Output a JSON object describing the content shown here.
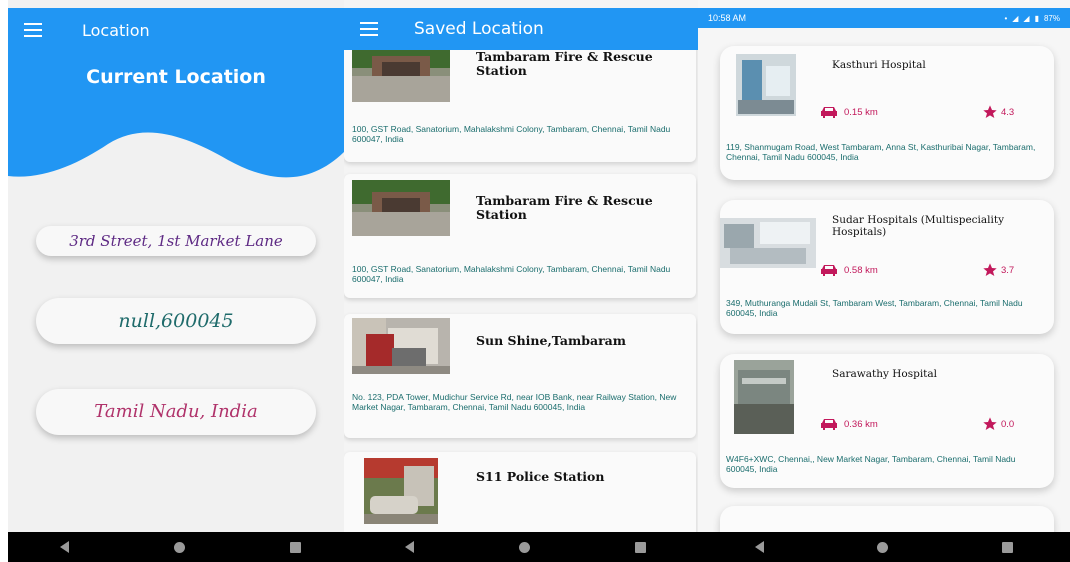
{
  "screen1": {
    "appbar_title": "Location",
    "header": "Current Location",
    "street": "3rd Street, 1st Market Lane",
    "zip": "null,600045",
    "state": "Tamil Nadu, India"
  },
  "screen2": {
    "appbar_title": "Saved Location",
    "items": [
      {
        "title": "Tambaram Fire & Rescue Station",
        "address": "100, GST Road, Sanatorium, Mahalakshmi Colony, Tambaram, Chennai, Tamil Nadu 600047, India"
      },
      {
        "title": "Tambaram Fire & Rescue Station",
        "address": "100, GST Road, Sanatorium, Mahalakshmi Colony, Tambaram, Chennai, Tamil Nadu 600047, India"
      },
      {
        "title": "Sun Shine,Tambaram",
        "address": "No. 123, PDA Tower, Mudichur Service Rd, near IOB Bank, near Railway Station, New Market Nagar, Tambaram, Chennai, Tamil Nadu 600045, India"
      },
      {
        "title": "S11 Police Station",
        "address": ""
      }
    ]
  },
  "screen3": {
    "status_time": "10:58 AM",
    "battery": "87%",
    "items": [
      {
        "name": "Kasthuri Hospital",
        "distance": "0.15 km",
        "rating": "4.3",
        "address": "119, Shanmugam Road, West Tambaram, Anna St, Kasthuribai Nagar, Tambaram, Chennai, Tamil Nadu 600045, India"
      },
      {
        "name": "Sudar Hospitals (Multispeciality Hospitals)",
        "distance": "0.58 km",
        "rating": "3.7",
        "address": "349, Muthuranga Mudali St, Tambaram West, Tambaram, Chennai, Tamil Nadu 600045, India"
      },
      {
        "name": "Sarawathy Hospital",
        "distance": "0.36 km",
        "rating": "0.0",
        "address": "W4F6+XWC, Chennai,, New Market Nagar, Tambaram, Chennai, Tamil Nadu 600045, India"
      }
    ]
  },
  "colors": {
    "primary": "#2196f3",
    "accent_pink": "#c2185b",
    "address_teal": "#1a6d6d"
  },
  "icons": [
    "menu-icon",
    "car-icon",
    "star-icon",
    "back-icon",
    "home-icon",
    "recents-icon"
  ]
}
